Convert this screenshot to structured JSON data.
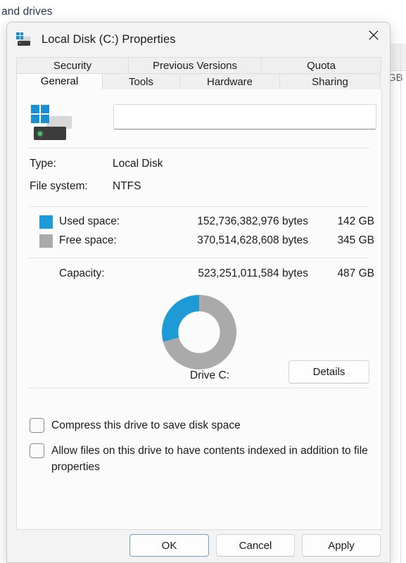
{
  "background": {
    "breadcrumb_text": "and drives",
    "partial_label": "GB"
  },
  "dialog": {
    "title": "Local Disk (C:) Properties",
    "title_icon": "drive-icon",
    "close_icon": "close-icon"
  },
  "tabs": {
    "row_top": [
      {
        "label": "Security",
        "selected": false
      },
      {
        "label": "Previous Versions",
        "selected": false
      },
      {
        "label": "Quota",
        "selected": false
      }
    ],
    "row_bottom": [
      {
        "label": "General",
        "selected": true
      },
      {
        "label": "Tools",
        "selected": false
      },
      {
        "label": "Hardware",
        "selected": false
      },
      {
        "label": "Sharing",
        "selected": false
      }
    ]
  },
  "general": {
    "volume_label_value": "",
    "volume_label_placeholder": "",
    "type_label": "Type:",
    "type_value": "Local Disk",
    "filesystem_label": "File system:",
    "filesystem_value": "NTFS",
    "used": {
      "label": "Used space:",
      "bytes": "152,736,382,976 bytes",
      "gb": "142 GB",
      "color": "#1d9bd7"
    },
    "free": {
      "label": "Free space:",
      "bytes": "370,514,628,608 bytes",
      "gb": "345 GB",
      "color": "#aaaaaa"
    },
    "capacity": {
      "label": "Capacity:",
      "bytes": "523,251,011,584 bytes",
      "gb": "487 GB"
    },
    "drive_caption": "Drive C:",
    "details_button": "Details",
    "compress_checkbox": {
      "label": "Compress this drive to save disk space",
      "checked": false
    },
    "index_checkbox": {
      "label": "Allow files on this drive to have contents indexed in addition to file properties",
      "checked": false
    }
  },
  "chart_data": {
    "type": "pie",
    "title": "Drive C:",
    "categories": [
      "Used space",
      "Free space"
    ],
    "values": [
      152736382976,
      370514628608
    ],
    "values_gb": [
      142,
      345
    ],
    "percentages": [
      29.2,
      70.8
    ],
    "colors": [
      "#1d9bd7",
      "#aaaaaa"
    ],
    "total": 523251011584,
    "total_gb": 487,
    "donut": true,
    "inner_radius_ratio": 0.56,
    "start_angle_deg": 0,
    "direction": "counterclockwise",
    "legend_position": "above",
    "grid": false,
    "xlabel": "",
    "ylabel": ""
  },
  "footer": {
    "ok": "OK",
    "cancel": "Cancel",
    "apply": "Apply"
  }
}
